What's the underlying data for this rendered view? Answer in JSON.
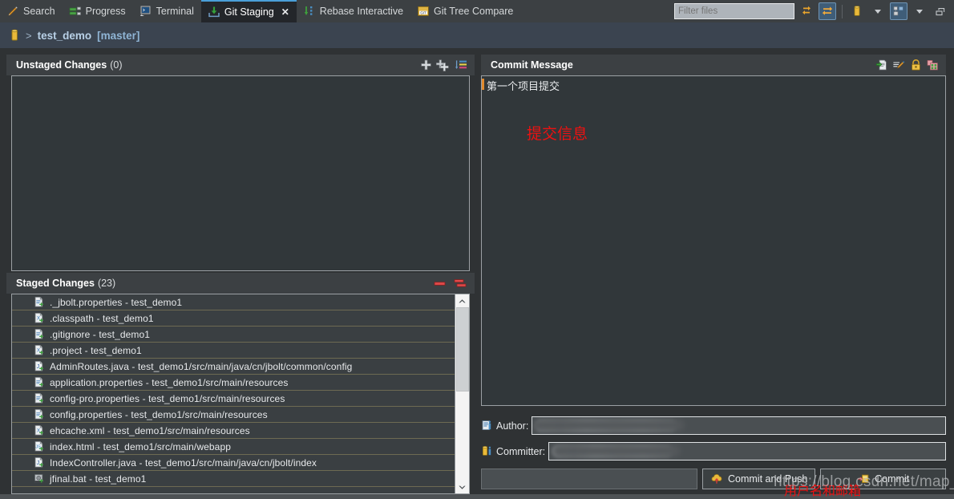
{
  "tabs": [
    {
      "label": "Search",
      "icon": "search-pencil-icon",
      "active": false,
      "closable": false
    },
    {
      "label": "Progress",
      "icon": "progress-icon",
      "active": false,
      "closable": false
    },
    {
      "label": "Terminal",
      "icon": "terminal-icon",
      "active": false,
      "closable": false
    },
    {
      "label": "Git Staging",
      "icon": "git-staging-icon",
      "active": true,
      "closable": true,
      "close_label": "✕"
    },
    {
      "label": "Rebase Interactive",
      "icon": "rebase-interactive-icon",
      "active": false,
      "closable": false
    },
    {
      "label": "Git Tree Compare",
      "icon": "git-tree-compare-icon",
      "active": false,
      "closable": false
    }
  ],
  "toolbar": {
    "filter": {
      "value": "",
      "placeholder": "Filter files"
    },
    "buttons": [
      {
        "name": "refresh-icon",
        "selected": false
      },
      {
        "name": "compare-mode-icon",
        "selected": true
      },
      {
        "name": "repository-icon",
        "selected": false
      },
      {
        "name": "repository-dropdown-caret",
        "selected": false
      },
      {
        "name": "presentation-icon",
        "selected": true
      },
      {
        "name": "view-menu-caret",
        "selected": false
      },
      {
        "name": "minimize-icon",
        "selected": false
      }
    ]
  },
  "breadcrumb": {
    "repo_icon": "repository-icon",
    "separator": ">",
    "repo": "test_demo",
    "branch": "[master]"
  },
  "unstaged": {
    "title": "Unstaged Changes",
    "count": "(0)",
    "tools": [
      "add-icon",
      "add-all-icon",
      "sort-filter-icon"
    ],
    "files": []
  },
  "staged": {
    "title": "Staged Changes",
    "count": "(23)",
    "tools": [
      "remove-icon",
      "remove-all-icon"
    ],
    "files": [
      {
        "name": "._jbolt.properties - test_demo1",
        "icon": "properties-file-icon"
      },
      {
        "name": ".classpath - test_demo1",
        "icon": "xml-file-icon"
      },
      {
        "name": ".gitignore - test_demo1",
        "icon": "properties-file-icon"
      },
      {
        "name": ".project - test_demo1",
        "icon": "xml-file-icon"
      },
      {
        "name": "AdminRoutes.java - test_demo1/src/main/java/cn/jbolt/common/config",
        "icon": "java-file-icon"
      },
      {
        "name": "application.properties - test_demo1/src/main/resources",
        "icon": "properties-file-icon"
      },
      {
        "name": "config-pro.properties - test_demo1/src/main/resources",
        "icon": "properties-file-icon"
      },
      {
        "name": "config.properties - test_demo1/src/main/resources",
        "icon": "properties-file-icon"
      },
      {
        "name": "ehcache.xml - test_demo1/src/main/resources",
        "icon": "xml-file-icon"
      },
      {
        "name": "index.html - test_demo1/src/main/webapp",
        "icon": "html-file-icon"
      },
      {
        "name": "IndexController.java - test_demo1/src/main/java/cn/jbolt/index",
        "icon": "java-file-icon"
      },
      {
        "name": "jfinal.bat - test_demo1",
        "icon": "bat-file-icon"
      }
    ],
    "scrollbar": {
      "up": "▲",
      "down": "▼"
    }
  },
  "commit_message": {
    "title": "Commit Message",
    "tools": [
      "amend-icon",
      "signoff-icon",
      "gerrit-change-id-icon",
      "add-change-id-icon"
    ],
    "text": "第一个项目提交",
    "annotation": "提交信息"
  },
  "identity": {
    "author_label": "Author:",
    "author_icon": "author-icon",
    "author_value": "",
    "committer_label": "Committer:",
    "committer_icon": "committer-icon",
    "committer_value": "",
    "annotation": "用户名和邮箱"
  },
  "actions": {
    "commit_and_push": "Commit and Push",
    "commit": "Commit"
  },
  "watermark": "https://blog.csdn.net/map_ck",
  "colors": {
    "window_bg": "#2f3234",
    "panel_header": "#3c4043",
    "breadcrumb_bg": "#3b4450",
    "accent_blue": "#4a9fd8",
    "annotation_red": "#ee1111",
    "list_bg": "#3a3f42",
    "row_divider": "#6d6a52"
  }
}
